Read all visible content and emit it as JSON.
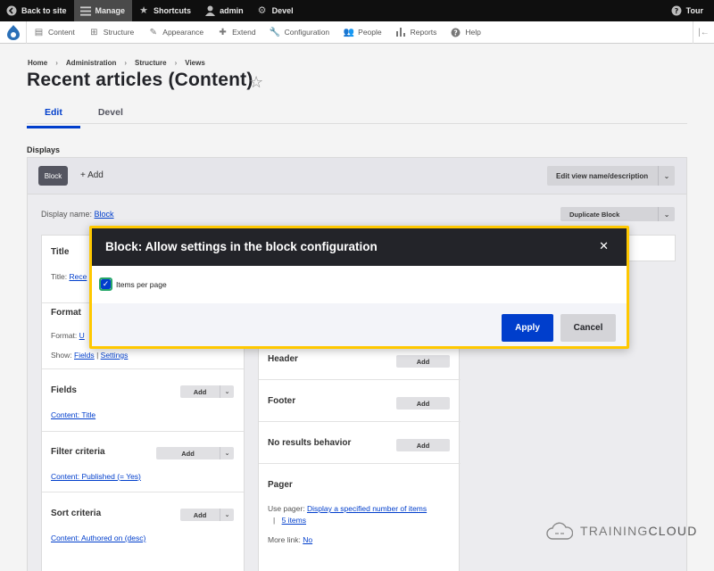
{
  "toolbar": {
    "items": [
      {
        "label": "Back to site",
        "icon": "back-arrow-icon"
      },
      {
        "label": "Manage",
        "icon": "hamburger-icon"
      },
      {
        "label": "Shortcuts",
        "icon": "star-icon"
      },
      {
        "label": "admin",
        "icon": "user-icon"
      },
      {
        "label": "Devel",
        "icon": "gear-icon"
      }
    ],
    "tour": "Tour"
  },
  "tray": {
    "items": [
      {
        "label": "Content"
      },
      {
        "label": "Structure"
      },
      {
        "label": "Appearance"
      },
      {
        "label": "Extend"
      },
      {
        "label": "Configuration"
      },
      {
        "label": "People"
      },
      {
        "label": "Reports"
      },
      {
        "label": "Help"
      }
    ]
  },
  "breadcrumb": [
    "Home",
    "Administration",
    "Structure",
    "Views"
  ],
  "page": {
    "title": "Recent articles (Content)",
    "tabs": [
      "Edit",
      "Devel"
    ],
    "displays_label": "Displays"
  },
  "displays": {
    "block_label": "Block",
    "add_label": "+ Add",
    "edit_view_label": "Edit view name/description",
    "display_name_label": "Display name:",
    "display_name_value": "Block",
    "duplicate_label": "Duplicate Block"
  },
  "col1": {
    "title_head": "Title",
    "title_text": "Title:",
    "title_link": "Rece",
    "format_head": "Format",
    "format_text": "Format:",
    "format_link": "U",
    "show_text": "Show:",
    "show_fields": "Fields",
    "show_sep": "|",
    "show_settings": "Settings",
    "fields_head": "Fields",
    "fields_link": "Content: Title",
    "filter_head": "Filter criteria",
    "filter_link": "Content: Published (= Yes)",
    "sort_head": "Sort criteria",
    "sort_link": "Content: Authored on (desc)",
    "add": "Add"
  },
  "col2": {
    "header_head": "Header",
    "footer_head": "Footer",
    "noresults_head": "No results behavior",
    "pager_head": "Pager",
    "use_pager": "Use pager:",
    "pager_link": "Display a specified number of items",
    "pager_sep": "|",
    "pager_items": "5 items",
    "more_link_label": "More link:",
    "more_link_value": "No",
    "add": "Add"
  },
  "watermark": {
    "training": "TRAINING",
    "cloud": "CLOUD"
  },
  "modal": {
    "title": "Block: Allow settings in the block configuration",
    "checkbox_label": "Items per page",
    "apply": "Apply",
    "cancel": "Cancel"
  },
  "colors": {
    "accent": "#003ecc",
    "modal_border": "#ffc800",
    "checkbox_focus": "#26a769"
  }
}
